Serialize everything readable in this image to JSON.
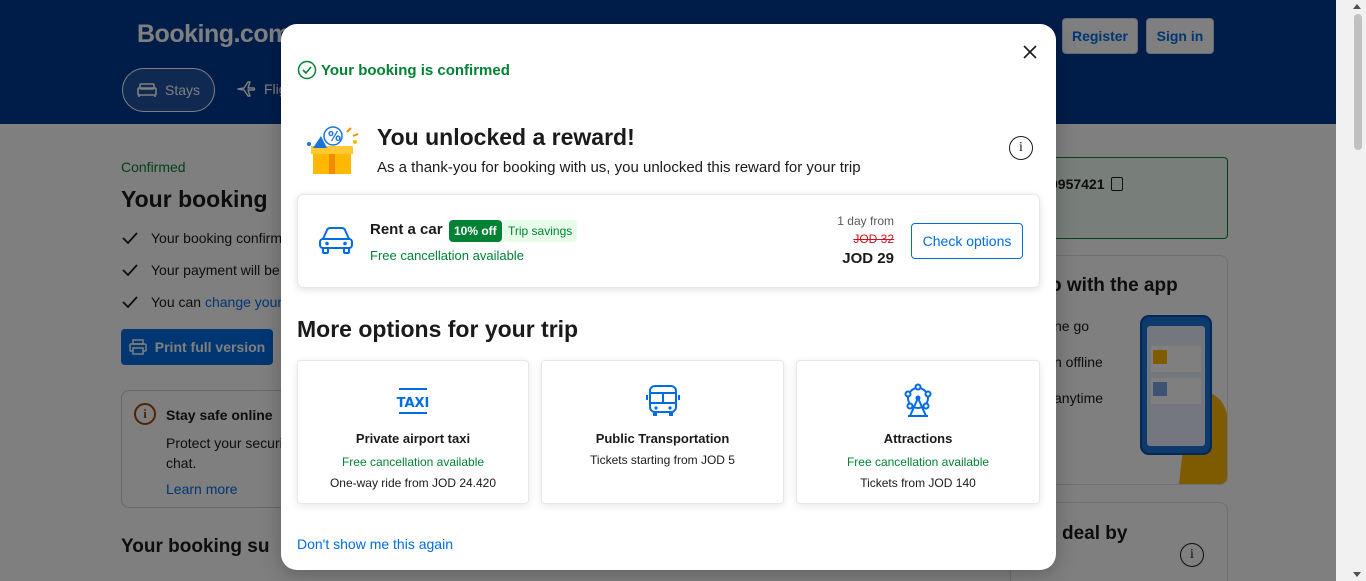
{
  "background": {
    "logo": "Booking.com",
    "header": {
      "register_label": "Register",
      "signin_label": "Sign in",
      "nav_stays": "Stays",
      "nav_flights": "Flig"
    },
    "confirmed_label": "Confirmed",
    "title": "Your booking",
    "checks": [
      "Your booking confirm",
      "Your payment will be"
    ],
    "check3_prefix": "You can ",
    "check3_link": "change your",
    "print_label": "Print full version",
    "safe": {
      "title": "Stay safe online",
      "text": "Protect your securi chat.",
      "link": "Learn more"
    },
    "summary_title": "Your booking su",
    "confirmation_number": "9957421",
    "app": {
      "title": "o with the app",
      "lines": [
        "ne go",
        "n offline",
        "anytime"
      ]
    },
    "deal_title": "deal by"
  },
  "modal": {
    "confirmed_text": "Your booking is confirmed",
    "reward_title": "You unlocked a reward!",
    "reward_subtitle": "As a thank-you for booking with us, you unlocked this reward for your trip",
    "car": {
      "name": "Rent a car",
      "badge_discount": "10% off",
      "badge_savings": "Trip savings",
      "free_cancel": "Free cancellation available",
      "day_from": "1 day from",
      "old_price": "JOD 32",
      "new_price": "JOD 29",
      "button": "Check options"
    },
    "more_title": "More options for your trip",
    "options": [
      {
        "name": "Private airport taxi",
        "free": "Free cancellation available",
        "detail": "One-way ride from JOD 24.420",
        "icon": "taxi-icon"
      },
      {
        "name": "Public Transportation",
        "detail": "Tickets starting from JOD 5",
        "icon": "bus-icon"
      },
      {
        "name": "Attractions",
        "free": "Free cancellation available",
        "detail": "Tickets from JOD 140",
        "icon": "ferris-wheel-icon"
      }
    ],
    "dont_show": "Don't show me this again"
  },
  "colors": {
    "brand_blue": "#003b95",
    "link_blue": "#006ce4",
    "green": "#008234",
    "strike_red": "#d4111e"
  }
}
